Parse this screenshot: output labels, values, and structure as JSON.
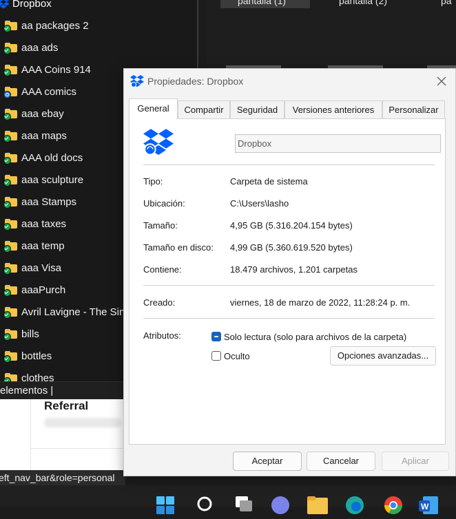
{
  "explorer": {
    "root_label": "Dropbox",
    "items": [
      {
        "label": "aa packages 2",
        "status": "synced"
      },
      {
        "label": "aaa ads",
        "status": "synced"
      },
      {
        "label": "AAA Coins 914",
        "status": "synced"
      },
      {
        "label": "AAA comics",
        "status": "syncing"
      },
      {
        "label": "aaa ebay",
        "status": "synced"
      },
      {
        "label": "aaa maps",
        "status": "synced"
      },
      {
        "label": "AAA old docs",
        "status": "synced"
      },
      {
        "label": "aaa sculpture",
        "status": "synced"
      },
      {
        "label": "aaa Stamps",
        "status": "synced"
      },
      {
        "label": "aaa taxes",
        "status": "synced"
      },
      {
        "label": "aaa temp",
        "status": "synced"
      },
      {
        "label": "aaa Visa",
        "status": "synced"
      },
      {
        "label": "aaaPurch",
        "status": "synced"
      },
      {
        "label": "Avril Lavigne - The Sin",
        "status": "synced"
      },
      {
        "label": "bills",
        "status": "synced"
      },
      {
        "label": "bottles",
        "status": "synced"
      },
      {
        "label": "clothes",
        "status": "synced"
      }
    ],
    "status_text": "elementos  |"
  },
  "background": {
    "tabs": [
      "pantalla (1)",
      "pantalla (2)",
      "pa"
    ],
    "webpage_title": "Referral",
    "url_fragment": "eft_nav_bar&role=personal"
  },
  "dialog": {
    "title": "Propiedades: Dropbox",
    "tabs": [
      "General",
      "Compartir",
      "Seguridad",
      "Versiones anteriores",
      "Personalizar"
    ],
    "active_tab": "General",
    "name_value": "Dropbox",
    "rows": [
      {
        "label": "Tipo:",
        "value": "Carpeta de sistema"
      },
      {
        "label": "Ubicación:",
        "value": "C:\\Users\\lasho"
      },
      {
        "label": "Tamaño:",
        "value": "4,95 GB (5.316.204.154 bytes)"
      },
      {
        "label": "Tamaño en disco:",
        "value": "4,99 GB (5.360.619.520 bytes)"
      },
      {
        "label": "Contiene:",
        "value": "18.479 archivos, 1.201 carpetas"
      }
    ],
    "created": {
      "label": "Creado:",
      "value": "viernes, 18 de marzo de 2022, 11:28:24 p. m."
    },
    "attributes_label": "Atributos:",
    "readonly_label": "Solo lectura (solo para archivos de la carpeta)",
    "hidden_label": "Oculto",
    "advanced_button": "Opciones avanzadas...",
    "ok_button": "Aceptar",
    "cancel_button": "Cancelar",
    "apply_button": "Aplicar",
    "accent_color": "#0061fe"
  },
  "taskbar": {
    "icons": [
      "windows-start-icon",
      "search-icon",
      "task-view-icon",
      "teams-icon",
      "file-explorer-icon",
      "edge-icon",
      "chrome-icon",
      "word-icon"
    ]
  }
}
